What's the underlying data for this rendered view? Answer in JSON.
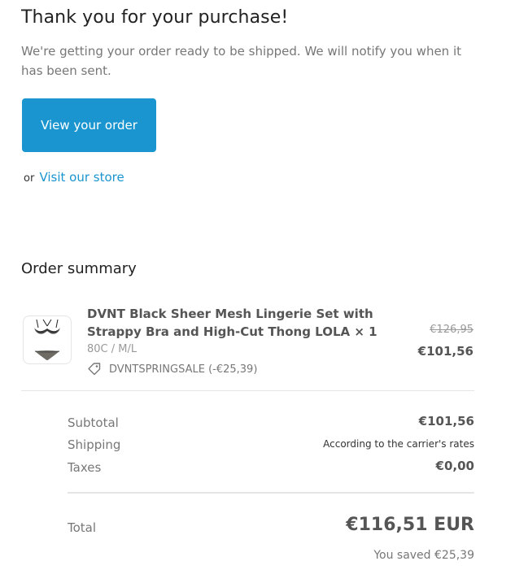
{
  "header": {
    "title": "Thank you for your purchase!",
    "intro": "We're getting your order ready to be shipped. We will notify you when it has been sent."
  },
  "actions": {
    "view_order_label": "View your order",
    "or_text": "or",
    "visit_store_label": "Visit our store"
  },
  "summary": {
    "heading": "Order summary",
    "item": {
      "name": "DVNT Black Sheer Mesh Lingerie Set with Strappy Bra and High-Cut Thong LOLA × 1",
      "variant": "80C / M/L",
      "discount_label": "DVNTSPRINGSALE (-€25,39)",
      "original_price": "€126,95",
      "price": "€101,56",
      "icon": "tag-icon"
    },
    "subtotal_label": "Subtotal",
    "subtotal_value": "€101,56",
    "shipping_label": "Shipping",
    "shipping_value": "According to the carrier's rates",
    "taxes_label": "Taxes",
    "taxes_value": "€0,00",
    "total_label": "Total",
    "total_value": "€116,51 EUR",
    "saved_text": "You saved €25,39"
  },
  "colors": {
    "accent": "#1b95cf",
    "text_primary": "#222222",
    "text_muted": "#777777",
    "divider": "#e5e5e5"
  }
}
